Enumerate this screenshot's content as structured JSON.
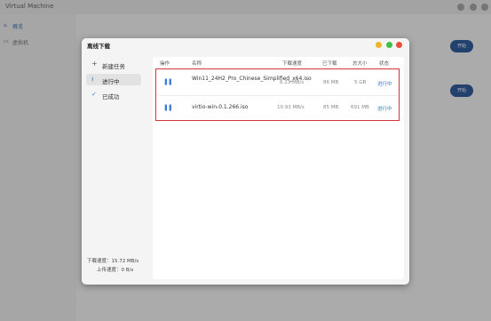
{
  "app": {
    "title": "Virtual Machine"
  },
  "background": {
    "nav": [
      {
        "label": "概览"
      },
      {
        "label": "虚拟机"
      }
    ],
    "buttons": [
      {
        "label": "开始"
      },
      {
        "label": "开始"
      }
    ]
  },
  "dialog": {
    "title": "离线下载",
    "sidebar": [
      {
        "icon": "plus-icon",
        "label": "新建任务"
      },
      {
        "icon": "download-icon",
        "label": "进行中"
      },
      {
        "icon": "check-icon",
        "label": "已成功"
      }
    ],
    "download_speed": "下载速度：15.72 MB/s",
    "upload_speed": "上传速度：0 B/s",
    "table": {
      "headers": [
        "操作",
        "名称",
        "下载速度",
        "已下载",
        "总大小",
        "状态"
      ],
      "rows": [
        {
          "name": "Win11_24H2_Pro_Chinese_Simplified_x64.iso",
          "speed": "6.23 MB/s",
          "downloaded": "86 MB",
          "total": "5 GB",
          "status": "进行中"
        },
        {
          "name": "virtio-win-0.1.266.iso",
          "speed": "10.93 MB/s",
          "downloaded": "85 MB",
          "total": "691 MB",
          "status": "进行中"
        }
      ]
    }
  },
  "colors": {
    "accent": "#3a7bd5",
    "highlight_border": "#d9333a",
    "close": "#ee4d3e",
    "minimize": "#f0b429",
    "maximize": "#3cc14a"
  }
}
